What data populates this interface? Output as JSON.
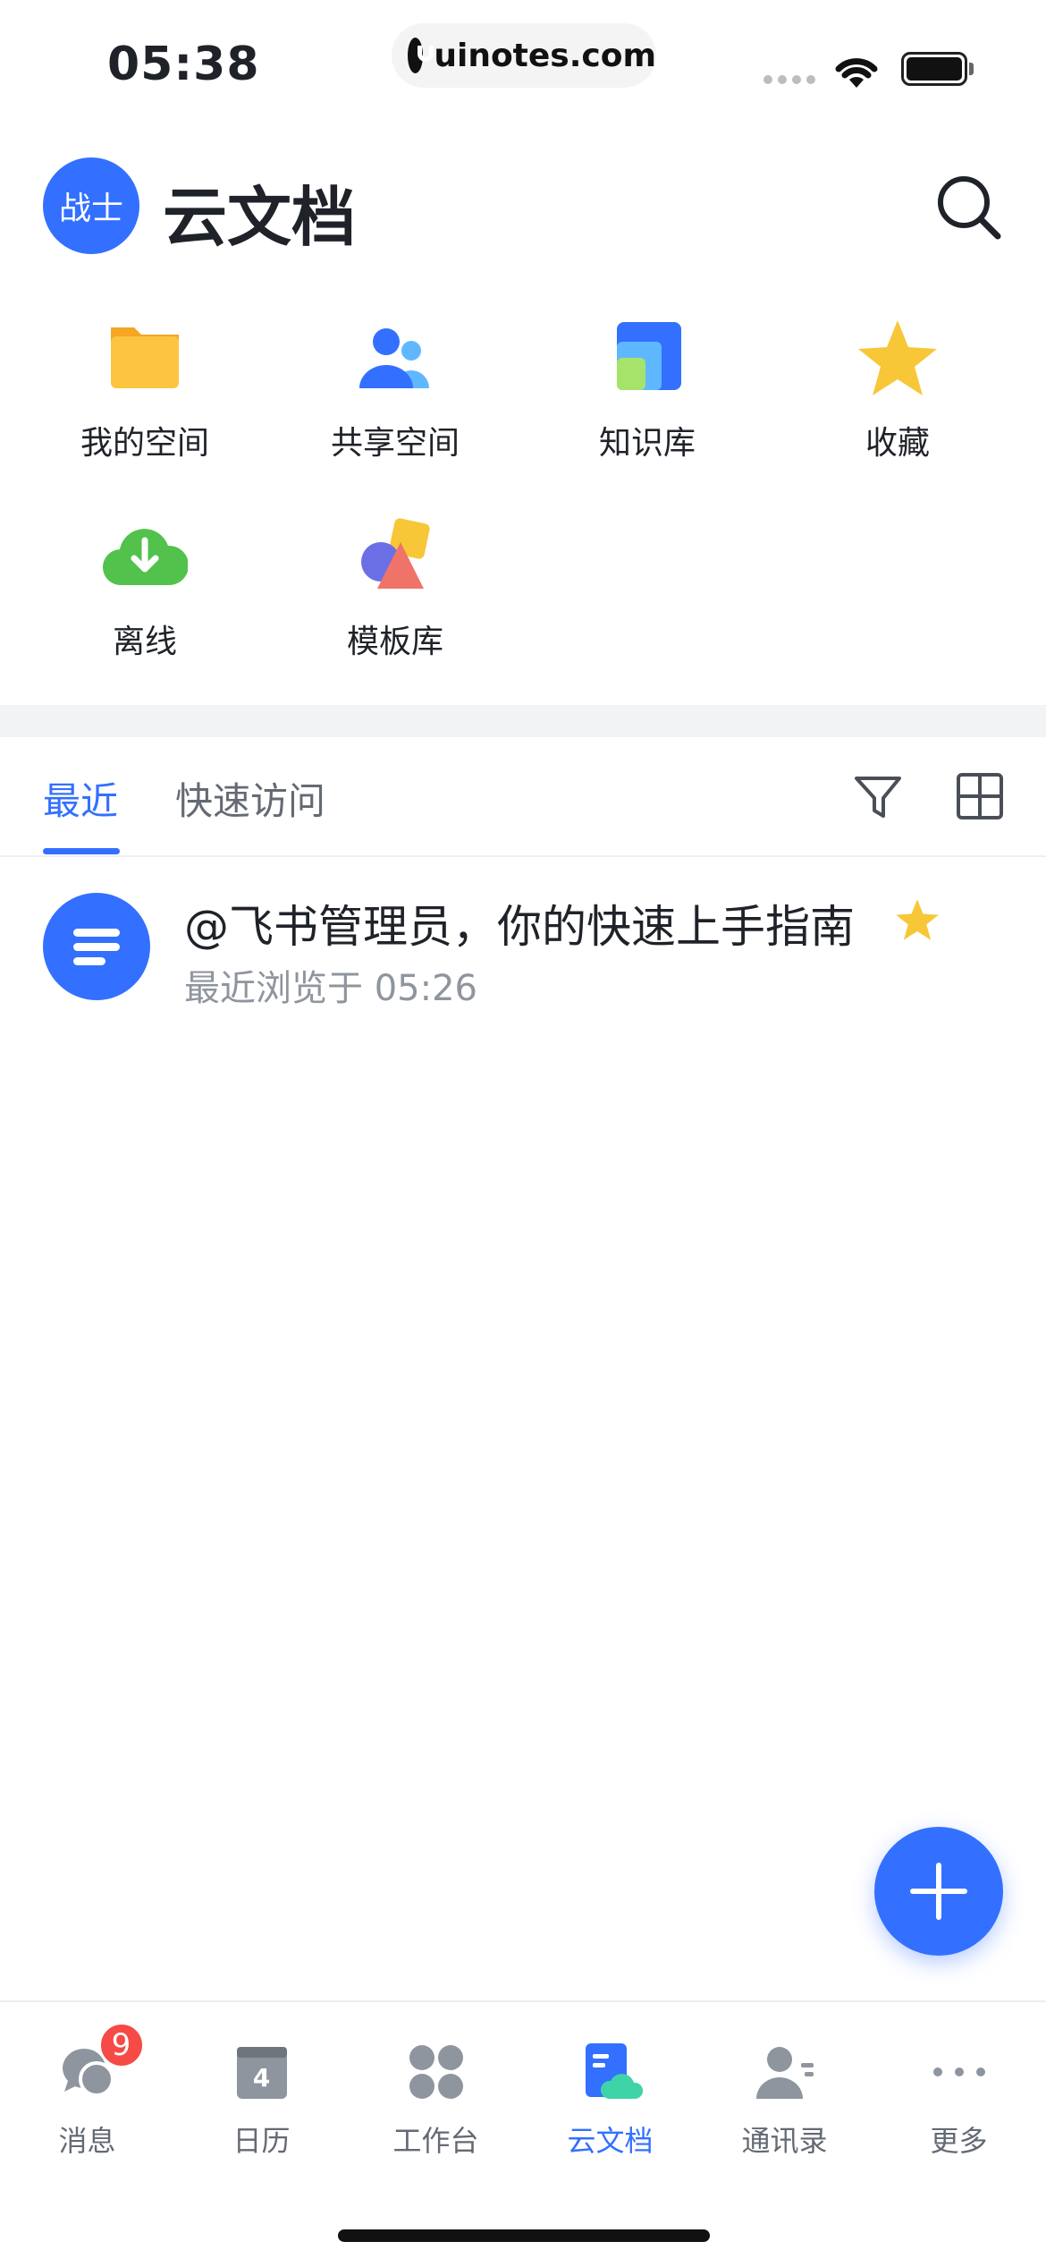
{
  "status_bar": {
    "time": "05:38",
    "url": "uinotes.com"
  },
  "header": {
    "avatar_text": "战士",
    "title": "云文档"
  },
  "quick_grid": [
    {
      "label": "我的空间",
      "icon": "folder-icon"
    },
    {
      "label": "共享空间",
      "icon": "shared-users-icon"
    },
    {
      "label": "知识库",
      "icon": "knowledge-base-icon"
    },
    {
      "label": "收藏",
      "icon": "star-icon"
    },
    {
      "label": "离线",
      "icon": "cloud-download-icon"
    },
    {
      "label": "模板库",
      "icon": "templates-icon"
    }
  ],
  "tabs": [
    {
      "label": "最近",
      "active": true
    },
    {
      "label": "快速访问",
      "active": false
    }
  ],
  "documents": [
    {
      "title": "@飞书管理员，你的快速上手指南",
      "subtitle": "最近浏览于 05:26",
      "starred": true
    }
  ],
  "bottom_nav": [
    {
      "label": "消息",
      "icon": "message-icon",
      "badge": "9",
      "active": false
    },
    {
      "label": "日历",
      "icon": "calendar-icon",
      "calendar_day": "4",
      "active": false
    },
    {
      "label": "工作台",
      "icon": "workbench-icon",
      "active": false
    },
    {
      "label": "云文档",
      "icon": "cloud-docs-icon",
      "active": true
    },
    {
      "label": "通讯录",
      "icon": "contacts-icon",
      "active": false
    },
    {
      "label": "更多",
      "icon": "more-icon",
      "active": false
    }
  ],
  "colors": {
    "accent": "#3370ff",
    "badge": "#f54a45",
    "star": "#f7c738"
  }
}
